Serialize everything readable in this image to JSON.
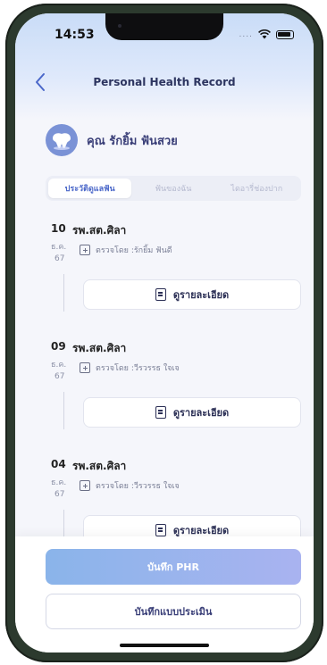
{
  "status_bar": {
    "time": "14:53",
    "signal": "....",
    "wifi_icon": "wifi-icon",
    "battery_icon": "battery-icon"
  },
  "nav": {
    "title": "Personal Health Record",
    "back_icon": "chevron-left-icon"
  },
  "profile": {
    "name": "คุณ รักยิ้ม ฟันสวย",
    "avatar_icon": "tooth-icon"
  },
  "tabs": [
    {
      "label": "ประวัติดูแลฟัน",
      "active": true
    },
    {
      "label": "ฟันของฉัน",
      "active": false
    },
    {
      "label": "ไดอารี่ช่องปาก",
      "active": false
    }
  ],
  "records": [
    {
      "day": "10",
      "month": "ธ.ค.",
      "year": "67",
      "place": "รพ.สต.ศิลา",
      "checked_by": "ตรวจโดย :รักยิ้ม ฟันดี",
      "detail_label": "ดูรายละเอียด"
    },
    {
      "day": "09",
      "month": "ธ.ค.",
      "year": "67",
      "place": "รพ.สต.ศิลา",
      "checked_by": "ตรวจโดย :วีรวรรธ ใจเจ",
      "detail_label": "ดูรายละเอียด"
    },
    {
      "day": "04",
      "month": "ธ.ค.",
      "year": "67",
      "place": "รพ.สต.ศิลา",
      "checked_by": "ตรวจโดย :วีรวรรธ ใจเจ",
      "detail_label": "ดูรายละเอียด"
    }
  ],
  "actions": {
    "primary": "บันทึก PHR",
    "secondary": "บันทึกแบบประเมิน"
  },
  "colors": {
    "accent": "#4a67c9",
    "primary_gradient_start": "#8ab4ea",
    "primary_gradient_end": "#a9b3f0"
  }
}
